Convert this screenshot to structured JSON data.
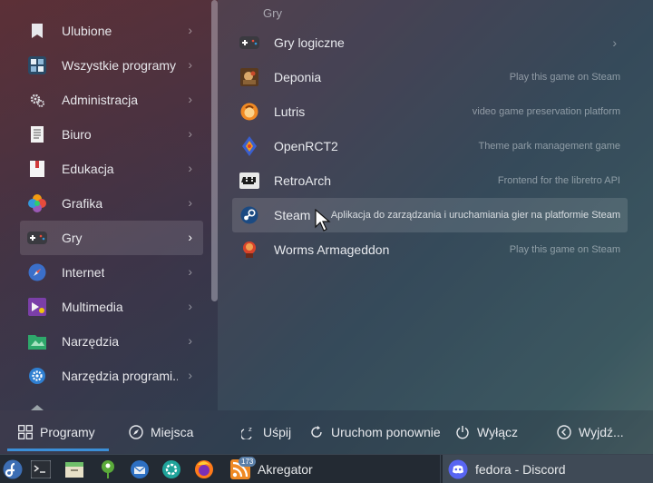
{
  "categories": [
    {
      "label": "Ulubione",
      "icon": "bookmark-icon"
    },
    {
      "label": "Wszystkie programy",
      "icon": "all-apps-icon"
    },
    {
      "label": "Administracja",
      "icon": "admin-gears-icon"
    },
    {
      "label": "Biuro",
      "icon": "office-document-icon"
    },
    {
      "label": "Edukacja",
      "icon": "education-book-icon"
    },
    {
      "label": "Grafika",
      "icon": "graphics-palette-icon"
    },
    {
      "label": "Gry",
      "icon": "gamepad-icon",
      "active": true
    },
    {
      "label": "Internet",
      "icon": "internet-compass-icon"
    },
    {
      "label": "Multimedia",
      "icon": "multimedia-icon"
    },
    {
      "label": "Narzędzia",
      "icon": "tools-folder-icon"
    },
    {
      "label": "Narzędzia programi...",
      "icon": "dev-tools-gear-icon"
    }
  ],
  "apps": {
    "section": "Gry",
    "items": [
      {
        "name": "Gry logiczne",
        "desc": "",
        "icon": "gamepad-icon",
        "submenu": true
      },
      {
        "name": "Deponia",
        "desc": "Play this game on Steam",
        "icon": "deponia-icon"
      },
      {
        "name": "Lutris",
        "desc": "video game preservation platform",
        "icon": "lutris-icon"
      },
      {
        "name": "OpenRCT2",
        "desc": "Theme park management game",
        "icon": "openrct2-icon"
      },
      {
        "name": "RetroArch",
        "desc": "Frontend for the libretro API",
        "icon": "retroarch-icon"
      },
      {
        "name": "Steam",
        "desc": "Aplikacja do zarządzania i uruchamiania gier na platformie Steam",
        "icon": "steam-icon",
        "active": true
      },
      {
        "name": "Worms Armageddon",
        "desc": "Play this game on Steam",
        "icon": "worms-icon"
      }
    ]
  },
  "bottom": {
    "programs": "Programy",
    "places": "Miejsca",
    "sleep": "Uśpij",
    "restart": "Uruchom ponownie",
    "shutdown": "Wyłącz",
    "logout": "Wyjdź..."
  },
  "taskbar": {
    "akregator_badge": "173",
    "task1": "Akregator",
    "task2": "fedora - Discord"
  },
  "colors": {
    "accent": "#3b8fd8",
    "taskbar": "#232a33"
  }
}
